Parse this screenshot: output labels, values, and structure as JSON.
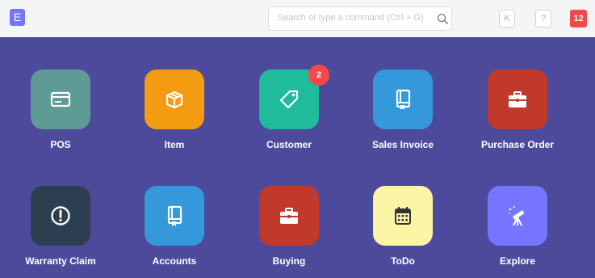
{
  "topbar": {
    "logo_letter": "E",
    "search_placeholder": "Search or type a command (Ctrl + G)",
    "keyboard_label": "K",
    "help_label": "?",
    "notification_count": "12"
  },
  "tiles": [
    {
      "label": "POS",
      "color": "#5e9b95",
      "icon": "credit-card-icon"
    },
    {
      "label": "Item",
      "color": "#f39c12",
      "icon": "box-icon"
    },
    {
      "label": "Customer",
      "color": "#1fbc9c",
      "icon": "tag-icon",
      "badge": "2"
    },
    {
      "label": "Sales Invoice",
      "color": "#3498db",
      "icon": "book-icon"
    },
    {
      "label": "Purchase Order",
      "color": "#c0392b",
      "icon": "briefcase-icon"
    },
    {
      "label": "Warranty Claim",
      "color": "#2c3e50",
      "icon": "exclamation-circle-icon"
    },
    {
      "label": "Accounts",
      "color": "#3498db",
      "icon": "book-icon"
    },
    {
      "label": "Buying",
      "color": "#c0392b",
      "icon": "briefcase-icon"
    },
    {
      "label": "ToDo",
      "color": "#fdf5a6",
      "icon": "calendar-icon"
    },
    {
      "label": "Explore",
      "color": "#7575ff",
      "icon": "telescope-icon"
    }
  ]
}
